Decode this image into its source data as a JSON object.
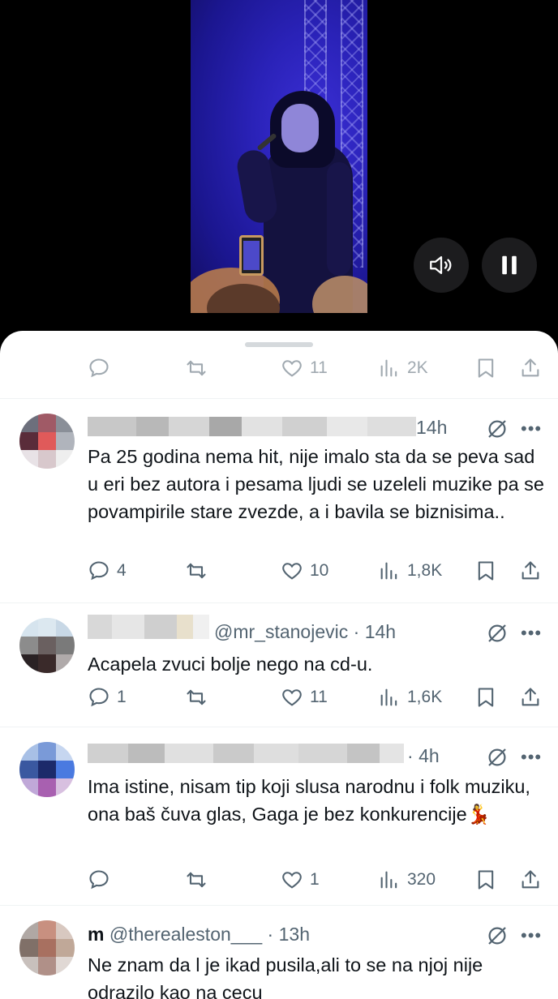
{
  "video": {
    "mute_icon": "speaker-icon",
    "pause_icon": "pause-icon"
  },
  "main_tweet_actions": {
    "reply_count": "",
    "retweet_count": "",
    "like_count": "11",
    "views": "2K"
  },
  "replies": [
    {
      "handle": "",
      "time": "14h",
      "text": "Pa 25 godina nema hit, nije imalo sta da se peva sad u eri bez autora i pesama ljudi se uzeleli muzike pa se povampirile stare zvezde, a i bavila se biznisima..",
      "reply_count": "4",
      "retweet_count": "",
      "like_count": "10",
      "views": "1,8K",
      "avatar_colors": [
        "#6d6f7c",
        "#a05a66",
        "#8a8f98",
        "#5a2c3a",
        "#e05a5a",
        "#b0b4bc",
        "#e8e2e6",
        "#d8c8cc",
        "#eeeeee"
      ]
    },
    {
      "handle": "@mr_stanojevic",
      "time": "14h",
      "text": "Acapela zvuci bolje nego na cd-u.",
      "reply_count": "1",
      "retweet_count": "",
      "like_count": "11",
      "views": "1,6K",
      "avatar_colors": [
        "#d6e4ee",
        "#dce8f0",
        "#c8d8e6",
        "#8c8c8c",
        "#6a6060",
        "#7a7a7a",
        "#2a2224",
        "#3a2a2a",
        "#b0aaaa"
      ]
    },
    {
      "handle": "",
      "time": "4h",
      "text": "Ima istine, nisam tip koji slusa narodnu i folk muziku, ona baš čuva glas, Gaga je bez konkurencije💃",
      "reply_count": "",
      "retweet_count": "",
      "like_count": "1",
      "views": "320",
      "avatar_colors": [
        "#a8c0e6",
        "#7a9ad8",
        "#c6d6f0",
        "#3a58a0",
        "#1c2a6a",
        "#4a7ae0",
        "#c0a8d8",
        "#a860b0",
        "#d8c0e0"
      ]
    },
    {
      "name": "m",
      "handle": "@therealeston___",
      "time": "13h",
      "text": "Ne znam da l je ikad pusila,ali to se na njoj nije odrazilo kao na cecu",
      "avatar_colors": [
        "#b0a8a4",
        "#c89080",
        "#d8c8c0",
        "#807068",
        "#a87060",
        "#c0a898",
        "#c8c0bc",
        "#b09088",
        "#e0d8d4"
      ]
    }
  ]
}
